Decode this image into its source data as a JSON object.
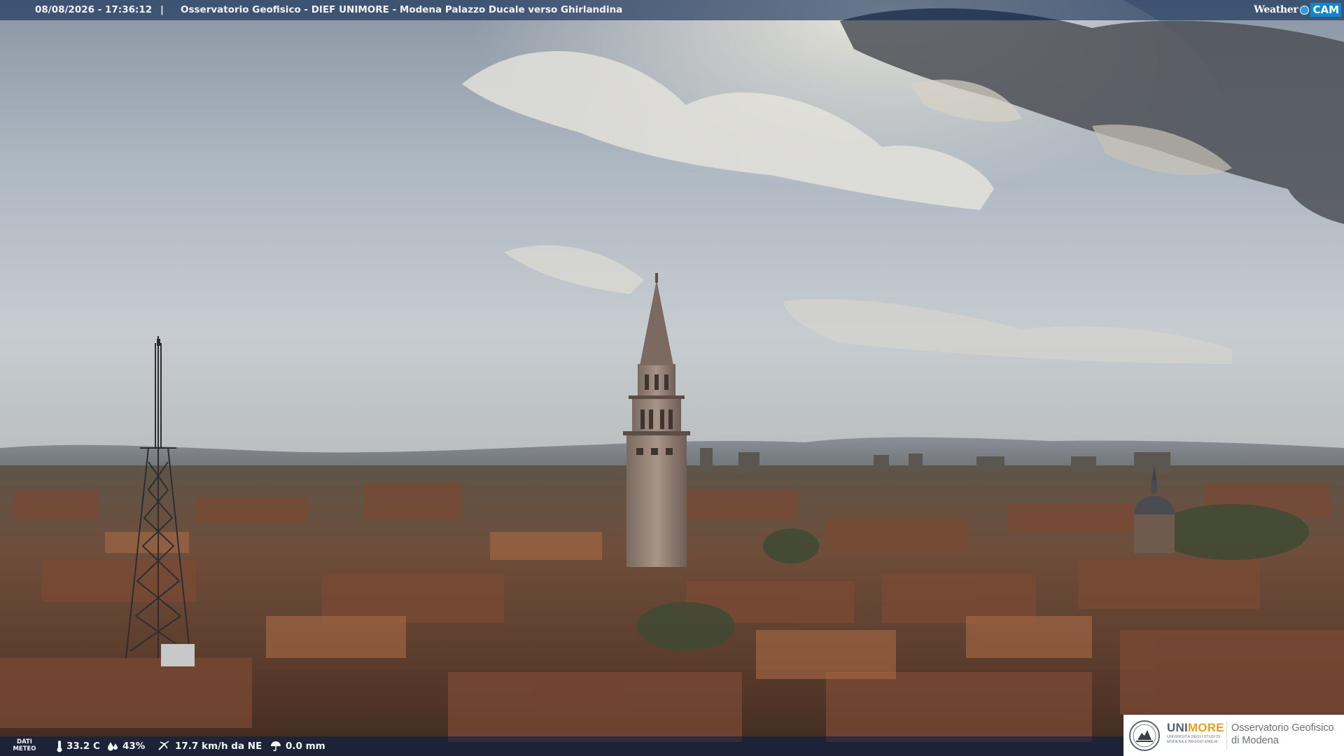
{
  "header": {
    "timestamp": "08/08/2026 - 17:36:12",
    "separator": "|",
    "caption": "Osservatorio Geofisico - DIEF UNIMORE - Modena Palazzo Ducale verso Ghirlandina",
    "brand_weather": "Weather",
    "brand_cam": "CAM"
  },
  "weather": {
    "label_line1": "DATI",
    "label_line2": "METEO",
    "temperature": "33.2 C",
    "humidity": "43%",
    "wind": "17.7 km/h da NE",
    "rain": "0.0 mm"
  },
  "logo": {
    "uni_part1": "UNI",
    "uni_part2": "MORE",
    "uni_sub": "UNIVERSITÀ DEGLI STUDI DI MODENA E REGGIO EMILIA",
    "title_line1": "Osservatorio Geofisico",
    "title_line2": "di Modena"
  },
  "colors": {
    "overlay_bar": "#001c48",
    "wcam_blue": "#0f86d2",
    "unimore_orange": "#e8a020"
  }
}
